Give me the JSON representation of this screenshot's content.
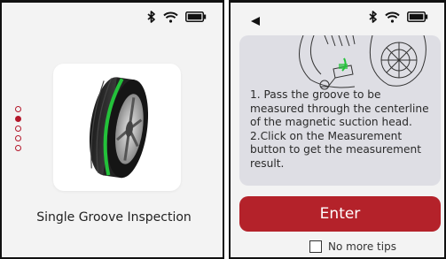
{
  "left_screen": {
    "feature_label": "Single Groove Inspection",
    "pager": {
      "total": 5,
      "active_index": 1
    },
    "status_icons": [
      "bluetooth-icon",
      "wifi-icon",
      "battery-icon"
    ]
  },
  "right_screen": {
    "tip_text": "1. Pass the groove to be measured through the centerline of the magnetic suction head.\n2.Click on the Measurement button to get the measurement result.",
    "enter_label": "Enter",
    "no_more_tips_label": "No more tips",
    "no_more_tips_checked": false,
    "status_icons": [
      "bluetooth-icon",
      "wifi-icon",
      "battery-icon"
    ]
  },
  "colors": {
    "accent_red": "#b4222a",
    "tire_green": "#23c23a",
    "screen_bg": "#f3f3f3",
    "tip_bg": "#dedee4"
  }
}
